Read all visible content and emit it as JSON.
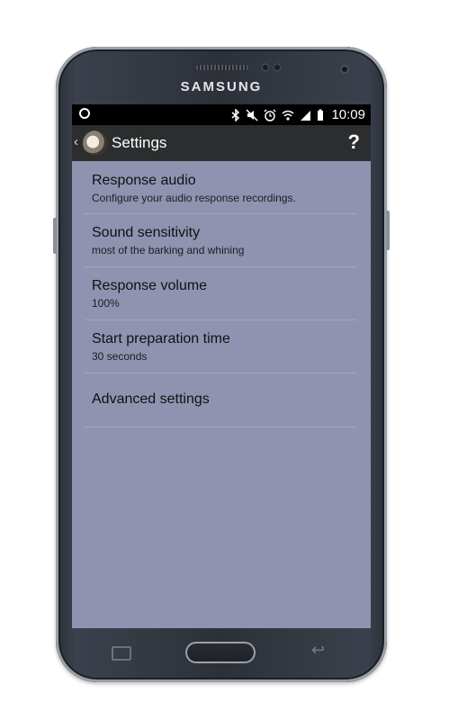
{
  "device": {
    "brand": "SAMSUNG"
  },
  "status_bar": {
    "time": "10:09",
    "icons": [
      "notification-circle-icon",
      "bluetooth-icon",
      "mute-icon",
      "alarm-icon",
      "wifi-icon",
      "signal-icon",
      "battery-icon"
    ]
  },
  "app_bar": {
    "title": "Settings",
    "back_glyph": "‹",
    "help_glyph": "?"
  },
  "settings": [
    {
      "title": "Response audio",
      "summary": "Configure your audio response recordings."
    },
    {
      "title": "Sound sensitivity",
      "summary": "most of the barking and whining"
    },
    {
      "title": "Response volume",
      "summary": "100%"
    },
    {
      "title": "Start preparation time",
      "summary": "30 seconds"
    },
    {
      "title": "Advanced settings"
    }
  ],
  "colors": {
    "screen_background": "#8f93b0",
    "app_bar": "#2b2d2f",
    "status_bar": "#000000"
  }
}
